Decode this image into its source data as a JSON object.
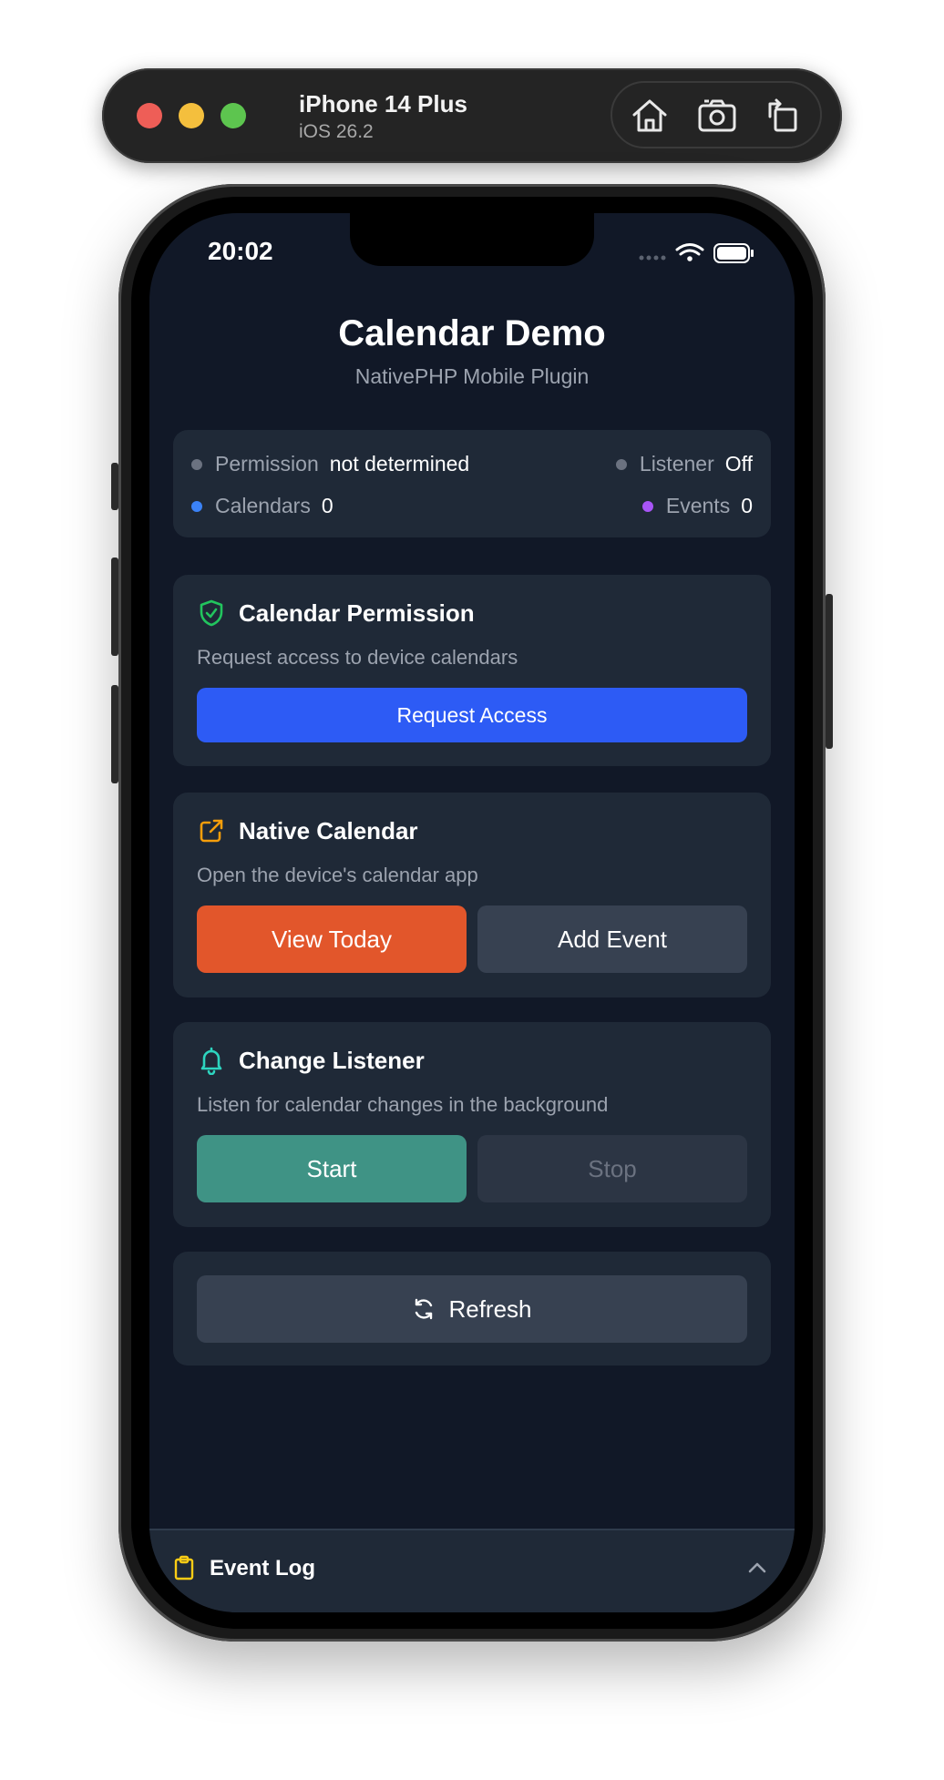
{
  "simulator": {
    "device_name": "iPhone 14 Plus",
    "os_version": "iOS 26.2",
    "tools": [
      "home-icon",
      "screenshot-icon",
      "rotate-icon"
    ]
  },
  "status_bar": {
    "time": "20:02"
  },
  "header": {
    "title": "Calendar Demo",
    "subtitle": "NativePHP Mobile Plugin"
  },
  "status": {
    "permission": {
      "label": "Permission",
      "value": "not determined",
      "color": "#6b7280"
    },
    "listener": {
      "label": "Listener",
      "value": "Off",
      "color": "#6b7280"
    },
    "calendars": {
      "label": "Calendars",
      "value": "0",
      "color": "#3b82f6"
    },
    "events": {
      "label": "Events",
      "value": "0",
      "color": "#a855f7"
    }
  },
  "permission_card": {
    "title": "Calendar Permission",
    "description": "Request access to device calendars",
    "button": "Request Access",
    "icon": "shield-check-icon"
  },
  "native_card": {
    "title": "Native Calendar",
    "description": "Open the device's calendar app",
    "view_today": "View Today",
    "add_event": "Add Event",
    "icon": "external-link-icon"
  },
  "listener_card": {
    "title": "Change Listener",
    "description": "Listen for calendar changes in the background",
    "start": "Start",
    "stop": "Stop",
    "icon": "bell-icon"
  },
  "refresh": {
    "label": "Refresh",
    "icon": "refresh-icon"
  },
  "event_log": {
    "label": "Event Log",
    "icon": "clipboard-icon"
  },
  "colors": {
    "background": "#111827",
    "card": "#1f2937",
    "primary": "#2d5bf5",
    "orange": "#e2562b",
    "teal": "#3f9385",
    "secondary": "#374151"
  }
}
